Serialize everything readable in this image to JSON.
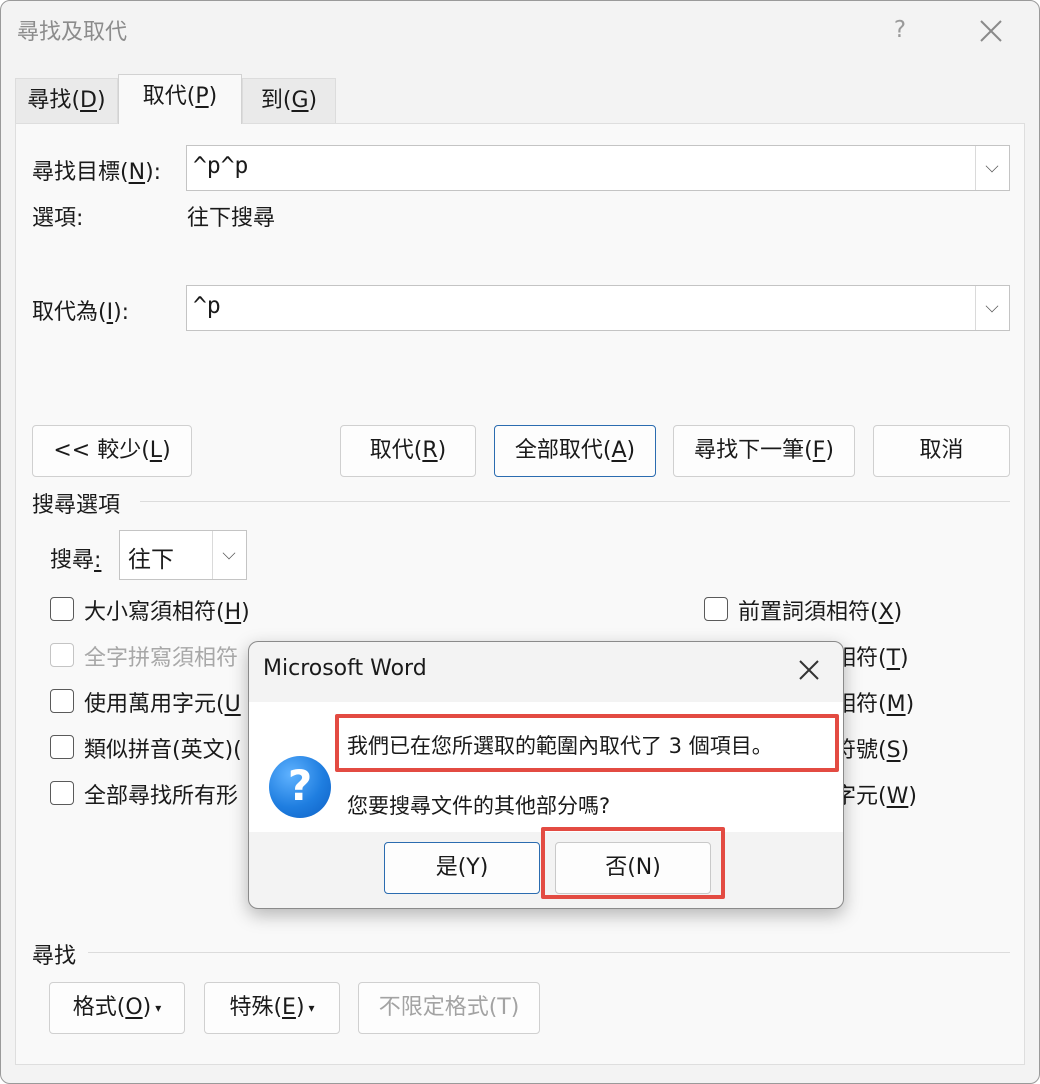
{
  "window": {
    "title": "尋找及取代",
    "help_label": "?",
    "close_icon": "close-icon"
  },
  "tabs": [
    {
      "label": "尋找",
      "hotkey": "D"
    },
    {
      "label": "取代",
      "hotkey": "P"
    },
    {
      "label": "到",
      "hotkey": "G"
    }
  ],
  "active_tab": "取代",
  "find": {
    "label_prefix": "尋找目標(",
    "hotkey": "N",
    "label_suffix": "):",
    "value": "^p^p"
  },
  "options": {
    "label": "選項:",
    "value": "往下搜尋"
  },
  "replace": {
    "label_prefix": "取代為(",
    "hotkey": "I",
    "label_suffix": "):",
    "value": "^p"
  },
  "buttons": {
    "less": {
      "prefix": "<< 較少(",
      "hotkey": "L",
      "suffix": ")"
    },
    "replace": {
      "prefix": "取代(",
      "hotkey": "R",
      "suffix": ")"
    },
    "replace_all": {
      "prefix": "全部取代(",
      "hotkey": "A",
      "suffix": ")"
    },
    "find_next": {
      "prefix": "尋找下一筆(",
      "hotkey": "F",
      "suffix": ")"
    },
    "cancel": "取消"
  },
  "search_options": {
    "section_title": "搜尋選項",
    "search_label": "搜尋",
    "search_value": "往下",
    "left_checkboxes": [
      {
        "label": "大小寫須相符(",
        "hotkey": "H",
        "suffix": ")",
        "checked": false,
        "enabled": true
      },
      {
        "label": "全字拼寫須相符",
        "hotkey": "",
        "suffix": "",
        "checked": false,
        "enabled": false
      },
      {
        "label": "使用萬用字元(",
        "hotkey": "U",
        "suffix": "",
        "checked": false,
        "enabled": true
      },
      {
        "label": "類似拼音(英文)(",
        "hotkey": "",
        "suffix": "",
        "checked": false,
        "enabled": true
      },
      {
        "label": "全部尋找所有形",
        "hotkey": "",
        "suffix": "",
        "checked": false,
        "enabled": true
      }
    ],
    "right_checkboxes": [
      {
        "label": "前置詞須相符(",
        "hotkey": "X",
        "suffix": ")",
        "checked": false,
        "enabled": true
      },
      {
        "label": "相符(",
        "hotkey": "T",
        "suffix": ")",
        "checked": false,
        "enabled": true
      },
      {
        "label": "相符(",
        "hotkey": "M",
        "suffix": ")",
        "checked": false,
        "enabled": true
      },
      {
        "label": "符號(",
        "hotkey": "S",
        "suffix": ")",
        "checked": false,
        "enabled": true
      },
      {
        "label": "字元(",
        "hotkey": "W",
        "suffix": ")",
        "checked": false,
        "enabled": true
      }
    ]
  },
  "find_section": {
    "title": "尋找",
    "format": {
      "prefix": "格式(",
      "hotkey": "O",
      "suffix": ")"
    },
    "special": {
      "prefix": "特殊(",
      "hotkey": "E",
      "suffix": ")"
    },
    "no_format": "不限定格式(T)"
  },
  "message_box": {
    "title": "Microsoft Word",
    "line1": "我們已在您所選取的範圍內取代了 3 個項目。",
    "line2": "您要搜尋文件的其他部分嗎?",
    "yes": "是(Y)",
    "no": "否(N)",
    "icon": "question-icon",
    "highlight_color": "#e34b42"
  }
}
